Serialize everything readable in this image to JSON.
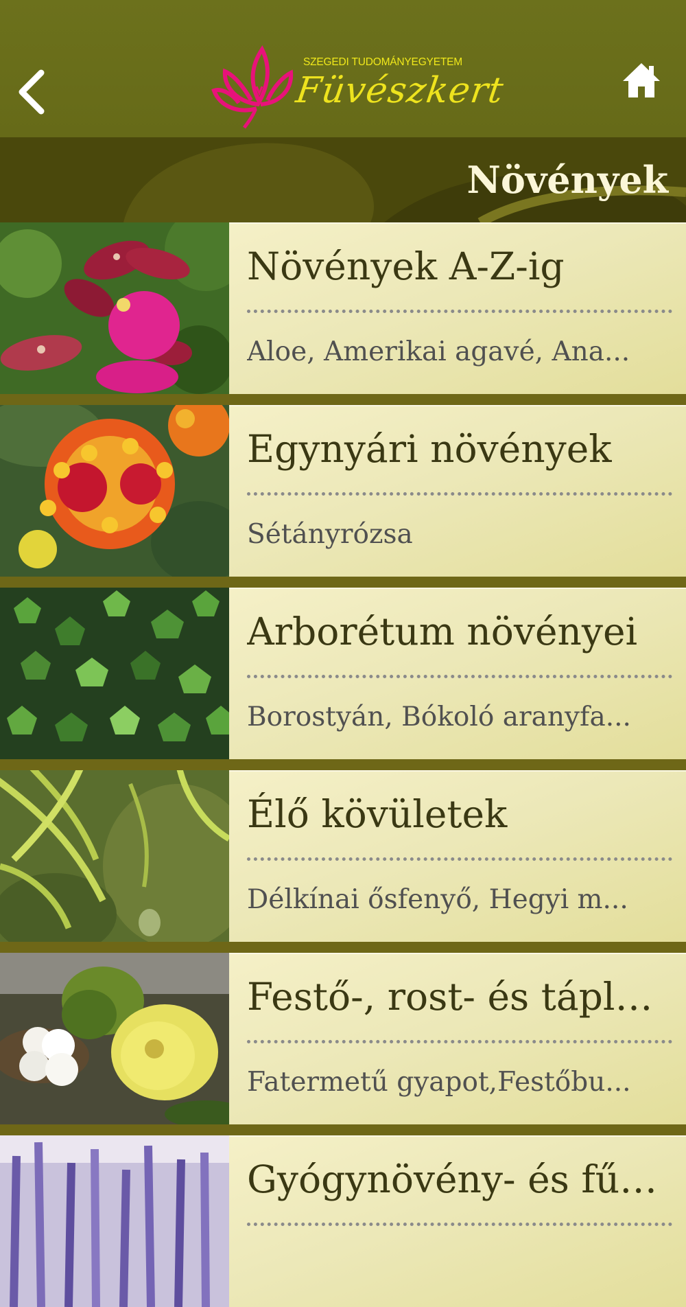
{
  "header": {
    "logo_top": "SZEGEDI TUDOMÁNYEGYETEM",
    "logo_script": "Füvészkert",
    "back_icon": "chevron-left-icon",
    "home_icon": "home-icon",
    "logo_color": "#e8127a",
    "accent": "#eee31e"
  },
  "titlebar": {
    "title": "Növények"
  },
  "list": {
    "items": [
      {
        "title": "Növények A-Z-ig",
        "subtitle": "Aloe, Amerikai agavé, Ana...",
        "thumb": "orchid"
      },
      {
        "title": "Egynyári növények",
        "subtitle": "Sétányrózsa",
        "thumb": "lantana"
      },
      {
        "title": "Arborétum növényei",
        "subtitle": "Borostyán, Bókoló aranyfa...",
        "thumb": "ivy"
      },
      {
        "title": "Élő kövületek",
        "subtitle": "Délkínai ősfenyő, Hegyi m...",
        "thumb": "fern-conifer"
      },
      {
        "title": "Festő-, rost- és táplá...",
        "subtitle": "Fatermetű gyapot,Festőbu...",
        "thumb": "cotton"
      },
      {
        "title": "Gyógynövény- és fűs...",
        "subtitle": "",
        "thumb": "lavender"
      }
    ]
  }
}
